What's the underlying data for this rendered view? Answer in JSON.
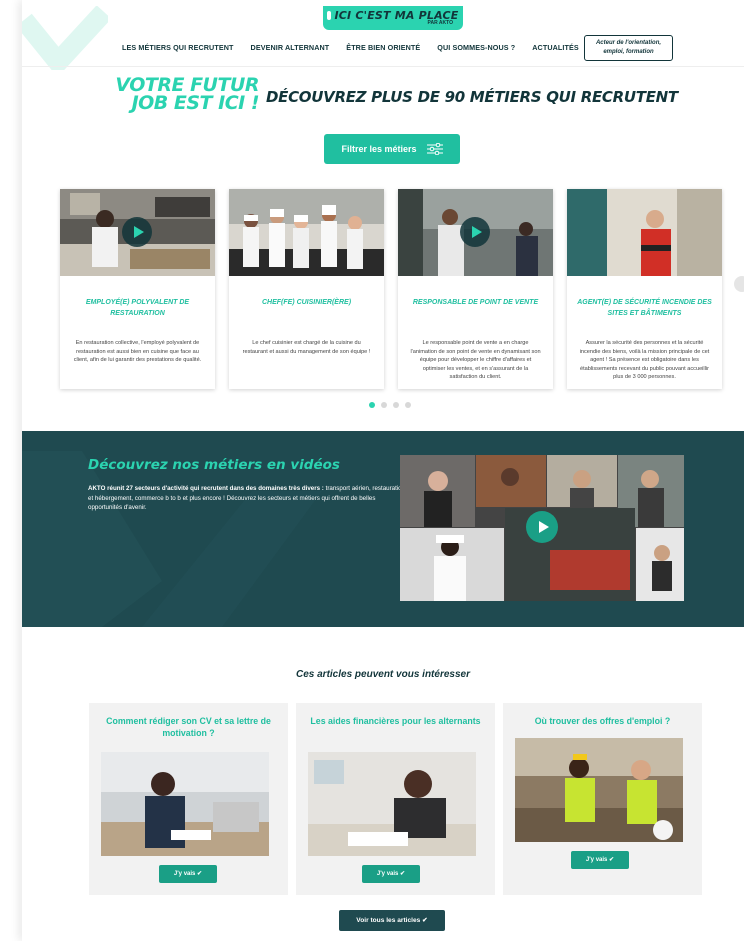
{
  "header": {
    "logo": "ICI C'EST MA PLACE",
    "logo_sub": "PAR AKTO",
    "nav": [
      "LES MÉTIERS QUI RECRUTENT",
      "DEVENIR ALTERNANT",
      "ÊTRE BIEN ORIENTÉ",
      "QUI SOMMES-NOUS ?",
      "ACTUALITÉS"
    ],
    "cta_line1": "Acteur de l'orientation,",
    "cta_line2": "emploi, formation"
  },
  "hero": {
    "left_line1": "VOTRE FUTUR",
    "left_line2": "JOB EST ICI !",
    "right": "DÉCOUVREZ PLUS DE 90 MÉTIERS QUI RECRUTENT",
    "filter_label": "Filtrer les métiers"
  },
  "jobs": [
    {
      "title": "EMPLOYÉ(E) POLYVALENT DE RESTAURATION",
      "description": "En restauration collective, l'employé polyvalent de restauration est aussi bien en cuisine que face au client, afin de lui garantir des prestations de qualité.",
      "has_video": true
    },
    {
      "title": "CHEF(FE) CUISINIER(ÈRE)",
      "description": "Le chef cuisinier est chargé de la cuisine du restaurant et aussi du management de son équipe !",
      "has_video": false
    },
    {
      "title": "RESPONSABLE DE POINT DE VENTE",
      "description": "Le responsable point de vente a en charge l'animation de son point de vente en dynamisant son équipe pour développer le chiffre d'affaires et optimiser les ventes, et en s'assurant de la satisfaction du client.",
      "has_video": true
    },
    {
      "title": "AGENT(E) DE SÉCURITÉ INCENDIE DES SITES ET BÂTIMENTS",
      "description": "Assurer la sécurité des personnes et la sécurité incendie des biens, voilà la mission principale de cet agent ! Sa présence est obligatoire dans les établissements recevant du public pouvant accueillir plus de 3 000 personnes.",
      "has_video": false
    }
  ],
  "carousel": {
    "pages": 4,
    "active": 1
  },
  "videos": {
    "title": "Découvrez nos métiers en vidéos",
    "text_bold": "AKTO réunit 27 secteurs d'activité qui recrutent dans des domaines très divers :",
    "text_rest": "transport aérien, restauration et hébergement, commerce b to b et plus encore ! Découvrez les secteurs et métiers qui offrent de belles opportunités d'avenir."
  },
  "articles": {
    "title": "Ces articles peuvent vous intéresser",
    "items": [
      {
        "title": "Comment rédiger son CV et sa lettre de motivation ?",
        "button": "J'y vais"
      },
      {
        "title": "Les aides financières pour les alternants",
        "button": "J'y vais"
      },
      {
        "title": "Où trouver des offres d'emploi ?",
        "button": "J'y vais"
      }
    ],
    "all_button": "Voir tous les articles"
  },
  "colors": {
    "accent": "#2bd3b0",
    "accent_dark": "#1a9f86",
    "navy": "#12353a",
    "band": "#1f4a50"
  }
}
